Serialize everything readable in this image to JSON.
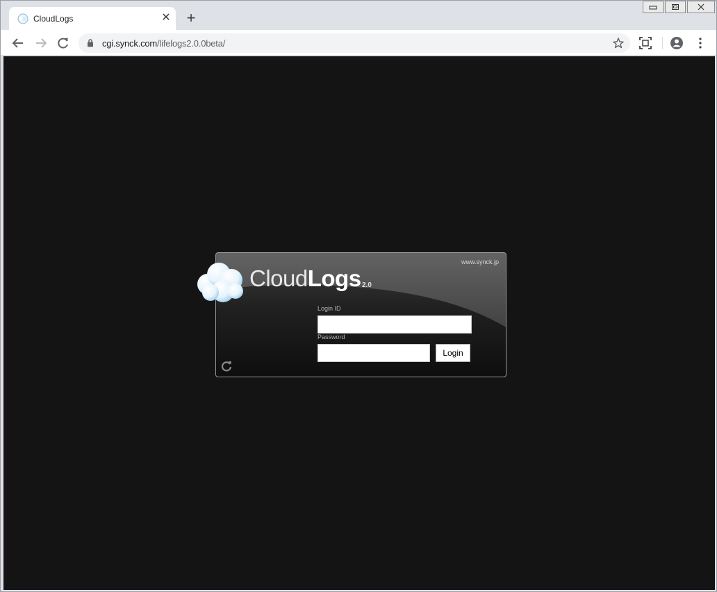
{
  "browser": {
    "tab_title": "CloudLogs",
    "tab_close_glyph": "✕",
    "new_tab_glyph": "+",
    "url_host": "cgi.synck.com",
    "url_path": "/lifelogs2.0.0beta/"
  },
  "page": {
    "site_link": "www.synck.jp",
    "logo_light": "Cloud",
    "logo_bold": "Logs",
    "logo_version": "2.0",
    "login_id_label": "Login ID",
    "login_id_value": "",
    "password_label": "Password",
    "password_value": "",
    "login_button": "Login"
  },
  "colors": {
    "page_background": "#141414",
    "panel_border": "#9a9a9a"
  },
  "icons": [
    "cloud-favicon",
    "back-arrow-icon",
    "forward-arrow-icon",
    "reload-icon",
    "lock-icon",
    "star-icon",
    "screenshot-icon",
    "account-icon",
    "menu-icon",
    "cloud-logo",
    "refresh-icon"
  ]
}
